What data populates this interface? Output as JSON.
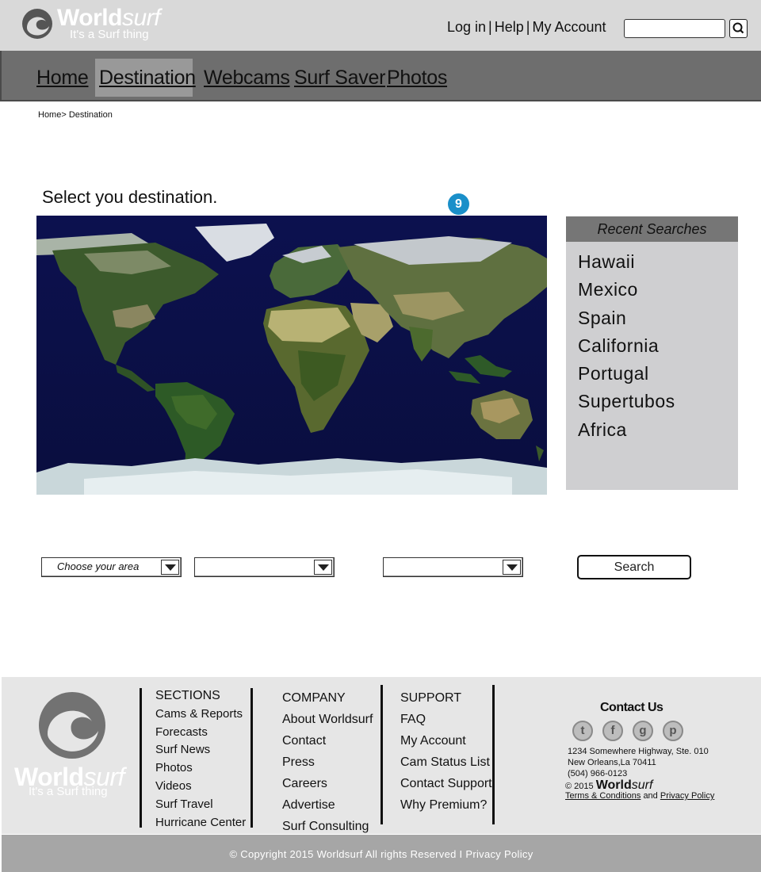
{
  "brand": {
    "name_bold": "World",
    "name_italic": "surf",
    "tagline": "It's a Surf thing"
  },
  "header": {
    "links": [
      "Log in",
      "Help",
      "My Account"
    ],
    "search_placeholder": ""
  },
  "nav": {
    "items": [
      "Home",
      "Destination",
      "Webcams",
      "Surf Saver",
      "Photos"
    ],
    "active": "Destination"
  },
  "breadcrumb": "Home> Destination",
  "page": {
    "heading": "Select you destination.",
    "badge": "9"
  },
  "recent": {
    "title": "Recent Searches",
    "items": [
      "Hawaii",
      "Mexico",
      "Spain",
      "California",
      "Portugal",
      "Supertubos",
      "Africa"
    ]
  },
  "filters": {
    "area_value": "Choose your area",
    "second_value": "",
    "third_value": "",
    "search_label": "Search"
  },
  "footer": {
    "sections": {
      "title": "SECTIONS",
      "items": [
        "Cams & Reports",
        "Forecasts",
        "Surf News",
        "Photos",
        "Videos",
        "Surf Travel",
        "Hurricane Center"
      ]
    },
    "company": {
      "title": "COMPANY",
      "items": [
        "About Worldsurf",
        "Contact",
        "Press",
        "Careers",
        "Advertise",
        "Surf Consulting"
      ]
    },
    "support": {
      "title": "SUPPORT",
      "items": [
        "FAQ",
        "My Account",
        "Cam Status List",
        "Contact Support",
        "Why Premium?"
      ]
    },
    "contact": {
      "title": "Contact Us",
      "address1": "1234 Somewhere Highway, Ste. 010",
      "address2": "New Orleans,La 70411",
      "phone": "(504) 966-0123",
      "copy_year": "© 2015",
      "terms": "Terms & Conditions",
      "and": "and",
      "privacy": "Privacy Policy",
      "social_icons": [
        "twitter-icon",
        "facebook-icon",
        "google-icon",
        "pinterest-icon"
      ]
    },
    "copyright": "© Copyright 2015 Worldsurf All rights Reserved I Privacy Policy"
  }
}
